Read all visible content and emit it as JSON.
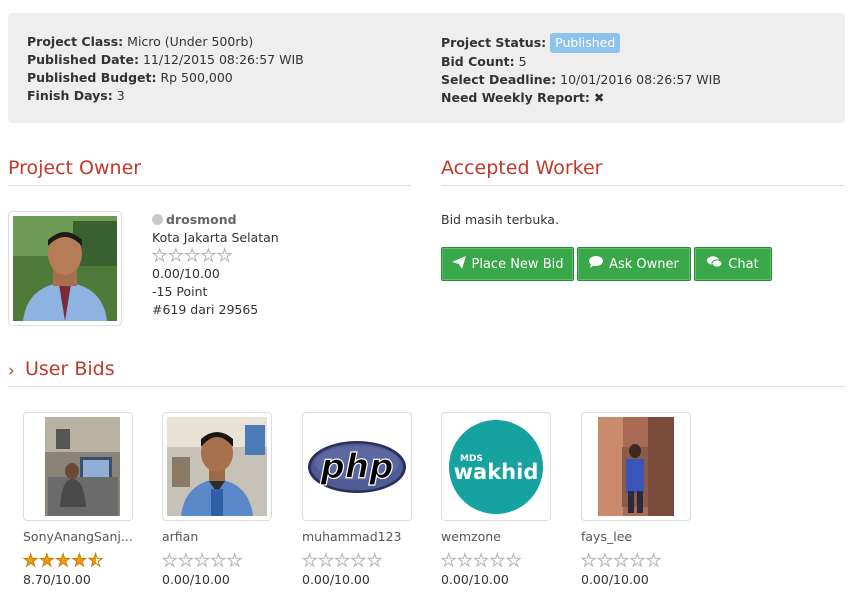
{
  "project_info": {
    "class_label": "Project Class:",
    "class_value": "Micro (Under 500rb)",
    "published_date_label": "Published Date:",
    "published_date_value": "11/12/2015 08:26:57 WIB",
    "budget_label": "Published Budget:",
    "budget_value": "Rp 500,000",
    "finish_label": "Finish Days:",
    "finish_value": "3",
    "status_label": "Project Status:",
    "status_value": "Published",
    "bid_count_label": "Bid Count:",
    "bid_count_value": "5",
    "deadline_label": "Select Deadline:",
    "deadline_value": "10/01/2016 08:26:57 WIB",
    "weekly_label": "Need Weekly Report:",
    "weekly_value": "✖"
  },
  "owner_section": {
    "title": "Project Owner",
    "username": "drosmond",
    "location": "Kota Jakarta Selatan",
    "rating": 0,
    "score": "0.00/10.00",
    "points": "-15 Point",
    "rank": "#619 dari 29565"
  },
  "worker_section": {
    "title": "Accepted Worker",
    "status_text": "Bid masih terbuka.",
    "buttons": {
      "place_bid": "Place New Bid",
      "ask_owner": "Ask Owner",
      "chat": "Chat"
    }
  },
  "bids_section": {
    "title": "User Bids",
    "bids": [
      {
        "name": "SonyAnangSanj...",
        "rating": 4.5,
        "score": "8.70/10.00"
      },
      {
        "name": "arfian",
        "rating": 0,
        "score": "0.00/10.00"
      },
      {
        "name": "muhammad123",
        "rating": 0,
        "score": "0.00/10.00",
        "logo_text": "php"
      },
      {
        "name": "wemzone",
        "rating": 0,
        "score": "0.00/10.00",
        "logo_small": "MDS",
        "logo_text": "wakhid"
      },
      {
        "name": "fays_lee",
        "rating": 0,
        "score": "0.00/10.00"
      }
    ]
  },
  "colors": {
    "accent_red": "#c0392b",
    "button_green": "#3aa74a",
    "badge_blue": "#8dc2ea",
    "star_gold": "#f39c12",
    "wakhid_teal": "#16a29e",
    "php_blue": "#4f5b93"
  },
  "icons": {
    "place_bid": "paper-plane-icon",
    "ask_owner": "comment-icon",
    "chat": "comments-icon",
    "status": "offline-dot-icon",
    "section": "chevron-right-icon"
  }
}
